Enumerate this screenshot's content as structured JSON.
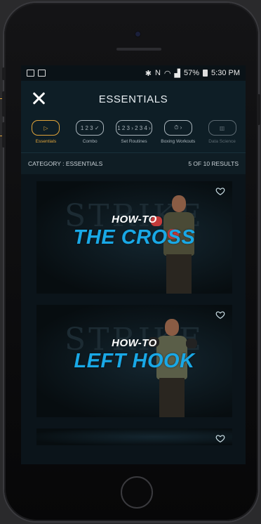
{
  "statusbar": {
    "battery": "57%",
    "time": "5:30 PM"
  },
  "header": {
    "title": "ESSENTIALS"
  },
  "tabs": [
    {
      "label": "Essentials",
      "glyph": "▷",
      "active": true
    },
    {
      "label": "Combo",
      "glyph": "1 2 3 ✓"
    },
    {
      "label": "Set Routines",
      "glyph": "1 2 3 › 2 3 4 ›"
    },
    {
      "label": "Boxing Workouts",
      "glyph": "⏱ ›"
    },
    {
      "label": "Data Science",
      "glyph": "▥"
    }
  ],
  "category": {
    "label": "CATEGORY : ESSENTIALS",
    "results": "5 OF 10 RESULTS"
  },
  "cards": [
    {
      "heading": "HOW-TO",
      "title": "THE CROSS",
      "watermark": "STRIKE"
    },
    {
      "heading": "HOW-TO",
      "title": "LEFT HOOK",
      "watermark": "STRIKE"
    }
  ],
  "colors": {
    "accent": "#e0a43a",
    "title_blue": "#19a8e6"
  },
  "icons": {
    "close": "close-icon",
    "favorite": "heart-icon"
  }
}
